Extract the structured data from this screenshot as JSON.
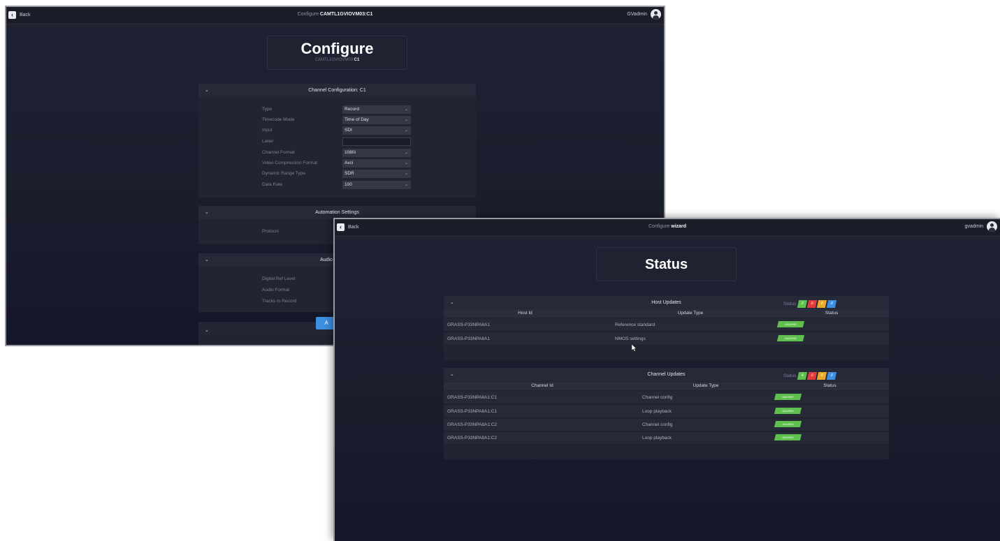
{
  "window1": {
    "back_label": "Back",
    "title_prefix": "Configure",
    "title_target": "CAMTL1GVIOVM03:C1",
    "user": "GVadmin",
    "header": {
      "title": "Configure",
      "sub_prefix": "CAMTL1GVIOVM03:",
      "sub_bold": "C1"
    },
    "channel_panel": {
      "title": "Channel Configuration: C1",
      "fields": [
        {
          "label": "Type",
          "value": "Record"
        },
        {
          "label": "Timecode Mode",
          "value": "Time of Day"
        },
        {
          "label": "Input",
          "value": "SDI"
        },
        {
          "label": "Label",
          "value": ""
        },
        {
          "label": "Channel Format",
          "value": "1080i"
        },
        {
          "label": "Video Compression Format",
          "value": "Avci"
        },
        {
          "label": "Dynamic Range Type",
          "value": "SDR"
        },
        {
          "label": "Data Rate",
          "value": "100"
        }
      ]
    },
    "automation_panel": {
      "title": "Automation Settings",
      "field_label": "Protocol"
    },
    "audio_panel": {
      "title": "Audio",
      "fields": [
        "Digital Ref Level",
        "Audio Format",
        "Tracks to Record"
      ]
    },
    "apply_button": "A"
  },
  "window2": {
    "back_label": "Back",
    "title_prefix": "Configure",
    "title_target": "wizard",
    "user": "gvadmin",
    "header": {
      "title": "Status"
    },
    "host_updates": {
      "title": "Host Updates",
      "status_label": "Status",
      "badges": [
        {
          "text": "2",
          "color": "#5fc04e"
        },
        {
          "text": "0",
          "color": "#e0393e"
        },
        {
          "text": "0",
          "color": "#e9a92b"
        },
        {
          "text": "0",
          "color": "#3d8fe0"
        }
      ],
      "columns": [
        "Host Id",
        "Update Type",
        "Status"
      ],
      "rows": [
        {
          "id": "GRASS-P33NPA8A1",
          "type": "Reference standard",
          "status": "success"
        },
        {
          "id": "GRASS-P33NPA8A1",
          "type": "NMOS settings",
          "status": "success"
        }
      ]
    },
    "channel_updates": {
      "title": "Channel Updates",
      "status_label": "Status",
      "badges": [
        {
          "text": "4",
          "color": "#5fc04e"
        },
        {
          "text": "0",
          "color": "#e0393e"
        },
        {
          "text": "0",
          "color": "#e9a92b"
        },
        {
          "text": "0",
          "color": "#3d8fe0"
        }
      ],
      "columns": [
        "Channel Id",
        "Update Type",
        "Status"
      ],
      "rows": [
        {
          "id": "GRASS-P33NPA8A1:C1",
          "type": "Channel config",
          "status": "success"
        },
        {
          "id": "GRASS-P33NPA8A1:C1",
          "type": "Loop playback",
          "status": "success"
        },
        {
          "id": "GRASS-P33NPA8A1:C2",
          "type": "Channel config",
          "status": "success"
        },
        {
          "id": "GRASS-P33NPA8A1:C2",
          "type": "Loop playback",
          "status": "success"
        }
      ]
    }
  }
}
